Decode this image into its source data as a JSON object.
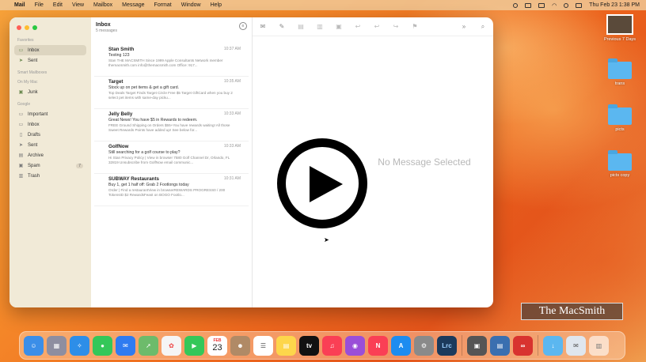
{
  "menubar": {
    "app": "Mail",
    "items": [
      "File",
      "Edit",
      "View",
      "Mailbox",
      "Message",
      "Format",
      "Window",
      "Help"
    ],
    "datetime": "Thu Feb 23  1:38 PM"
  },
  "sidebar": {
    "favorites_label": "Favorites",
    "favorites": [
      {
        "label": "Inbox",
        "icon": "inbox-icon"
      },
      {
        "label": "Sent",
        "icon": "paperplane-icon"
      }
    ],
    "smart_label": "Smart Mailboxes",
    "onmymac_label": "On My Mac",
    "onmymac": [
      {
        "label": "Junk",
        "icon": "junk-icon"
      }
    ],
    "google_label": "Google",
    "google": [
      {
        "label": "Important",
        "icon": "folder-icon",
        "count": ""
      },
      {
        "label": "Inbox",
        "icon": "inbox-icon",
        "count": ""
      },
      {
        "label": "Drafts",
        "icon": "drafts-icon",
        "count": ""
      },
      {
        "label": "Sent",
        "icon": "paperplane-icon",
        "count": ""
      },
      {
        "label": "Archive",
        "icon": "archive-icon",
        "count": ""
      },
      {
        "label": "Spam",
        "icon": "junk-icon",
        "count": "7"
      },
      {
        "label": "Trash",
        "icon": "trash-icon",
        "count": ""
      }
    ]
  },
  "list": {
    "title": "Inbox",
    "subtitle": "5 messages",
    "messages": [
      {
        "sender": "Stan Smith",
        "time": "10:37 AM",
        "subject": "Testing 123",
        "preview": "Stan THE MACSMITH Since 1999 Apple Consultants Network member themacsmith.com info@themacsmith.com Office: 917..."
      },
      {
        "sender": "Target",
        "time": "10:35 AM",
        "subject": "Stock up on pet items & get a gift card.",
        "preview": "Top Deals Target Finds Target Circle Free $5 Target GiftCard when you buy 2 select pet items with same-day picku..."
      },
      {
        "sender": "Jelly Belly",
        "time": "10:33 AM",
        "subject": "Great News! You have $5 in Rewards to redeem.",
        "preview": "FREE Ground Shipping on Orders $55+You have rewards waiting! All those Sweet Rewards Points have added up! See below for..."
      },
      {
        "sender": "GolfNow",
        "time": "10:33 AM",
        "subject": "Still searching for a golf course to play?",
        "preview": "Hi Stan Privacy Policy | View in browser 7580 Golf Channel Dr, Orlando, FL 32819 Unsubscribe from GolfNow email communic..."
      },
      {
        "sender": "SUBWAY Restaurants",
        "time": "10:31 AM",
        "subject": "Buy 1, get 1 half off: Grab 2 Footlongs today",
        "preview": "Order | Find a restaurantView in browserREWARDS PROGRESS0 / 200 TokensID $2 RewardsFeast on BOGO Footlo..."
      }
    ]
  },
  "viewer": {
    "empty_text": "No Message Selected"
  },
  "desktop": {
    "items": [
      {
        "label": "Previous 7 Days"
      },
      {
        "label": "trans"
      },
      {
        "label": "picts"
      },
      {
        "label": "picts copy"
      }
    ]
  },
  "watermark": "The MacSmith",
  "dock": {
    "calendar_month": "FEB",
    "calendar_day": "23",
    "tv_label": "tv",
    "lrc_label": "Lrc"
  }
}
